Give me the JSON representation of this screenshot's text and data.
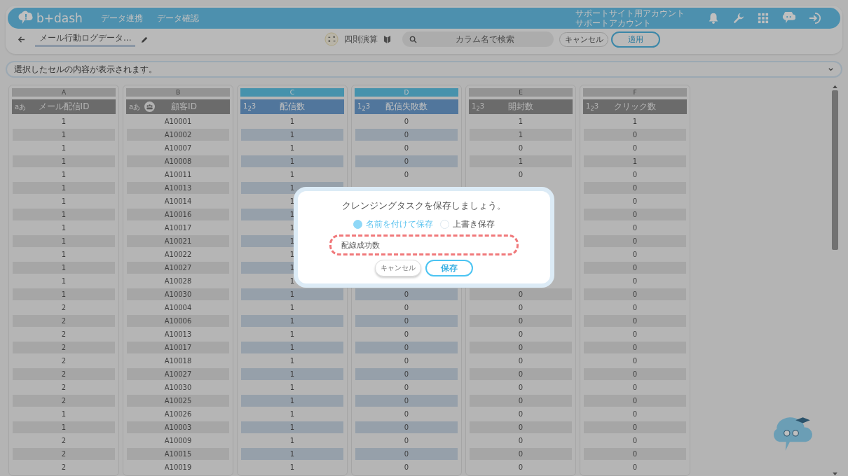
{
  "header": {
    "logo": "b+dash",
    "nav": [
      {
        "label": "データ連携"
      },
      {
        "label": "データ確認"
      }
    ],
    "account": [
      "サポートサイト用アカウント",
      "サポートアカウント"
    ]
  },
  "toolbar": {
    "title": "メール行動ログデータ...",
    "operation": "四則演算",
    "search": {
      "placeholder": "カラム名で検索"
    },
    "buttons": [
      {
        "label": "キャンセル",
        "kind": "secondary"
      },
      {
        "label": "適用",
        "kind": "primary"
      }
    ]
  },
  "cell_viewer": {
    "placeholder": "選択したセルの内容が表示されます。"
  },
  "columns": [
    {
      "letter": "A",
      "name": "メール配信ID",
      "type_label": "aあ",
      "selected": false,
      "group_icon": false
    },
    {
      "letter": "B",
      "name": "顧客ID",
      "type_label": "aあ",
      "selected": false,
      "group_icon": true
    },
    {
      "letter": "C",
      "name": "配信数",
      "type_label": "1$_{2}$3",
      "selected": true,
      "group_icon": false
    },
    {
      "letter": "D",
      "name": "配信失敗数",
      "type_label": "1$_{2}$3",
      "selected": true,
      "group_icon": false
    },
    {
      "letter": "E",
      "name": "開封数",
      "type_label": "1$_{2}$3",
      "selected": false,
      "group_icon": false
    },
    {
      "letter": "F",
      "name": "クリック数",
      "type_label": "1$_{2}$3",
      "selected": false,
      "group_icon": false
    }
  ],
  "rows": [
    [
      "1",
      "A10001",
      "1",
      "0",
      "1",
      "1"
    ],
    [
      "1",
      "A10002",
      "1",
      "0",
      "1",
      "0"
    ],
    [
      "1",
      "A10007",
      "1",
      "0",
      "0",
      "0"
    ],
    [
      "1",
      "A10008",
      "1",
      "0",
      "1",
      "1"
    ],
    [
      "1",
      "A10011",
      "1",
      "0",
      "0",
      "0"
    ],
    [
      "1",
      "A10013",
      "1",
      null,
      null,
      "0"
    ],
    [
      "1",
      "A10014",
      "1",
      null,
      null,
      "0"
    ],
    [
      "1",
      "A10016",
      "1",
      null,
      null,
      "0"
    ],
    [
      "1",
      "A10017",
      "1",
      null,
      null,
      "0"
    ],
    [
      "1",
      "A10021",
      "1",
      null,
      null,
      "0"
    ],
    [
      "1",
      "A10022",
      "1",
      null,
      null,
      "0"
    ],
    [
      "1",
      "A10027",
      "1",
      null,
      null,
      "0"
    ],
    [
      "1",
      "A10028",
      "1",
      null,
      null,
      "0"
    ],
    [
      "1",
      "A10030",
      "1",
      "0",
      "0",
      "0"
    ],
    [
      "2",
      "A10004",
      "1",
      "0",
      "0",
      "0"
    ],
    [
      "2",
      "A10006",
      "1",
      "0",
      "0",
      "0"
    ],
    [
      "2",
      "A10013",
      "1",
      "0",
      "0",
      "0"
    ],
    [
      "2",
      "A10017",
      "1",
      "0",
      "0",
      "0"
    ],
    [
      "2",
      "A10018",
      "1",
      "0",
      "0",
      "0"
    ],
    [
      "2",
      "A10027",
      "1",
      "0",
      "0",
      "0"
    ],
    [
      "2",
      "A10030",
      "1",
      "0",
      "0",
      "0"
    ],
    [
      "2",
      "A10025",
      "1",
      "0",
      "0",
      "0"
    ],
    [
      "1",
      "A10026",
      "1",
      "0",
      "0",
      "0"
    ],
    [
      "1",
      "A10003",
      "1",
      "0",
      "0",
      "0"
    ],
    [
      "2",
      "A10009",
      "1",
      "0",
      "0",
      "0"
    ],
    [
      "2",
      "A10015",
      "1",
      "0",
      "0",
      "0"
    ],
    [
      "2",
      "A10019",
      "1",
      "0",
      "0",
      "0"
    ]
  ],
  "dialog": {
    "title": "クレンジングタスクを保存しましょう。",
    "options": [
      {
        "label": "名前を付けて保存",
        "selected": true
      },
      {
        "label": "上書き保存",
        "selected": false
      }
    ],
    "name_field": {
      "value": "配線成功数",
      "highlighted": true
    },
    "buttons": [
      {
        "label": "キャンセル",
        "kind": "secondary"
      },
      {
        "label": "保存",
        "kind": "primary"
      }
    ]
  }
}
